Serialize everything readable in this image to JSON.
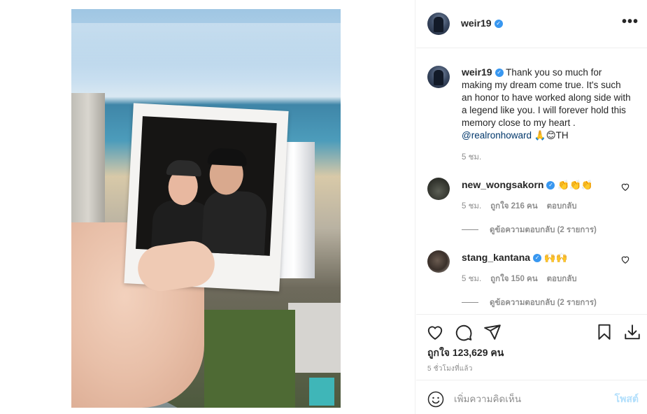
{
  "post": {
    "username": "weir19",
    "verified_glyph": "✓",
    "more_icon": "•••",
    "caption_text": "Thank you so much for making my dream come true. It's such an honor to have worked along side with a legend like you. I will forever hold this memory close to my heart .",
    "caption_mention": "@realronhoward",
    "caption_tail": "🙏😊TH",
    "caption_time": "5 ชม.",
    "likes": "ถูกใจ 123,629 คน",
    "time_ago": "5 ชั่วโมงที่แล้ว"
  },
  "comments": [
    {
      "username": "new_wongsakorn",
      "text": "👏👏👏",
      "time": "5 ชม.",
      "likes": "ถูกใจ 216 คน",
      "reply": "ตอบกลับ",
      "view_replies": "ดูข้อความตอบกลับ (2 รายการ)"
    },
    {
      "username": "stang_kantana",
      "text": "🙌🙌",
      "time": "5 ชม.",
      "likes": "ถูกใจ 150 คน",
      "reply": "ตอบกลับ",
      "view_replies": "ดูข้อความตอบกลับ (2 รายการ)"
    }
  ],
  "compose": {
    "placeholder": "เพิ่มความคิดเห็น",
    "post_label": "โพสต์"
  },
  "icons": {
    "like": "heart-icon",
    "comment": "comment-icon",
    "share": "share-icon",
    "save": "bookmark-icon",
    "download": "download-icon",
    "emoji": "smiley-icon"
  },
  "colors": {
    "verified": "#3897f0",
    "mention": "#00376b",
    "post_button": "#b2dffc",
    "muted": "#8e8e8e"
  }
}
